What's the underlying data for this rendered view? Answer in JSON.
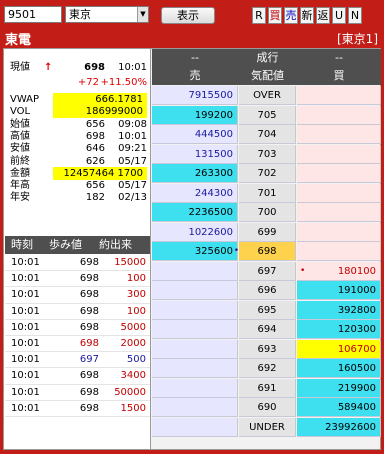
{
  "toolbar": {
    "code": "9501",
    "market": "東京",
    "show_label": "表示",
    "buttons": [
      "R",
      "買",
      "売",
      "新",
      "返",
      "U",
      "N"
    ]
  },
  "title": {
    "name": "東電",
    "market": "[東京1]"
  },
  "quote": {
    "current_label": "現値",
    "current_arrow": "↑",
    "current_price": "698",
    "current_time": "10:01",
    "change": "+72",
    "change_pct": "+11.50%",
    "rows": [
      {
        "label": "VWAP",
        "value": "666.1781",
        "time": "",
        "yellow": true
      },
      {
        "label": "VOL",
        "value": "186999000",
        "time": "",
        "yellow": true
      },
      {
        "label": "始値",
        "value": "656",
        "time": "09:08",
        "yellow": false
      },
      {
        "label": "高値",
        "value": "698",
        "time": "10:01",
        "yellow": false
      },
      {
        "label": "安値",
        "value": "646",
        "time": "09:21",
        "yellow": false
      },
      {
        "label": "前終",
        "value": "626",
        "time": "05/17",
        "yellow": false
      },
      {
        "label": "金額",
        "value": "12457464 1700",
        "time": "",
        "yellow": true
      },
      {
        "label": "年高",
        "value": "656",
        "time": "05/17",
        "yellow": false
      },
      {
        "label": "年安",
        "value": "182",
        "time": "02/13",
        "yellow": false
      }
    ]
  },
  "trades": {
    "headers": [
      "時刻",
      "歩み値",
      "約出来"
    ],
    "rows": [
      {
        "time": "10:01",
        "price": "698",
        "vol": "15000",
        "pc": "#000",
        "vc": "#c00000"
      },
      {
        "time": "10:01",
        "price": "698",
        "vol": "100",
        "pc": "#000",
        "vc": "#c00000"
      },
      {
        "time": "10:01",
        "price": "698",
        "vol": "300",
        "pc": "#000",
        "vc": "#c00000"
      },
      {
        "time": "10:01",
        "price": "698",
        "vol": "100",
        "pc": "#000",
        "vc": "#c00000"
      },
      {
        "time": "10:01",
        "price": "698",
        "vol": "5000",
        "pc": "#000",
        "vc": "#c00000"
      },
      {
        "time": "10:01",
        "price": "698",
        "vol": "2000",
        "pc": "#c00000",
        "vc": "#c00000"
      },
      {
        "time": "10:01",
        "price": "697",
        "vol": "500",
        "pc": "#1a1aa0",
        "vc": "#1a1aa0"
      },
      {
        "time": "10:01",
        "price": "698",
        "vol": "3400",
        "pc": "#000",
        "vc": "#c00000"
      },
      {
        "time": "10:01",
        "price": "698",
        "vol": "50000",
        "pc": "#000",
        "vc": "#c00000"
      },
      {
        "time": "10:01",
        "price": "698",
        "vol": "1500",
        "pc": "#000",
        "vc": "#c00000"
      }
    ]
  },
  "book": {
    "top": {
      "ask": "--",
      "mid": "成行",
      "bid": "--"
    },
    "headers": {
      "ask": "売",
      "mid": "気配値",
      "bid": "買"
    },
    "rows": [
      {
        "ask": "7915500",
        "price": "OVER",
        "bid": "",
        "ask_hl": "",
        "bid_hl": "",
        "px_hl": ""
      },
      {
        "ask": "199200",
        "price": "705",
        "bid": "",
        "ask_hl": "cyan",
        "bid_hl": "",
        "px_hl": ""
      },
      {
        "ask": "444500",
        "price": "704",
        "bid": "",
        "ask_hl": "",
        "bid_hl": "",
        "px_hl": ""
      },
      {
        "ask": "131500",
        "price": "703",
        "bid": "",
        "ask_hl": "",
        "bid_hl": "",
        "px_hl": ""
      },
      {
        "ask": "263300",
        "price": "702",
        "bid": "",
        "ask_hl": "cyan",
        "bid_hl": "",
        "px_hl": ""
      },
      {
        "ask": "244300",
        "price": "701",
        "bid": "",
        "ask_hl": "",
        "bid_hl": "",
        "px_hl": ""
      },
      {
        "ask": "2236500",
        "price": "700",
        "bid": "",
        "ask_hl": "cyan",
        "bid_hl": "",
        "px_hl": ""
      },
      {
        "ask": "1022600",
        "price": "699",
        "bid": "",
        "ask_hl": "",
        "bid_hl": "",
        "px_hl": ""
      },
      {
        "ask": "325600",
        "price": "698",
        "bid": "",
        "ask_hl": "cyan",
        "bid_hl": "",
        "px_hl": "orange",
        "ask_dot": "•"
      },
      {
        "ask": "",
        "price": "697",
        "bid": "180100",
        "ask_hl": "",
        "bid_hl": "",
        "px_hl": "",
        "bid_dot": "•"
      },
      {
        "ask": "",
        "price": "696",
        "bid": "191000",
        "ask_hl": "",
        "bid_hl": "cyan",
        "px_hl": ""
      },
      {
        "ask": "",
        "price": "695",
        "bid": "392800",
        "ask_hl": "",
        "bid_hl": "cyan",
        "px_hl": ""
      },
      {
        "ask": "",
        "price": "694",
        "bid": "120300",
        "ask_hl": "",
        "bid_hl": "cyan",
        "px_hl": ""
      },
      {
        "ask": "",
        "price": "693",
        "bid": "106700",
        "ask_hl": "",
        "bid_hl": "yellow",
        "px_hl": ""
      },
      {
        "ask": "",
        "price": "692",
        "bid": "160500",
        "ask_hl": "",
        "bid_hl": "cyan",
        "px_hl": ""
      },
      {
        "ask": "",
        "price": "691",
        "bid": "219900",
        "ask_hl": "",
        "bid_hl": "cyan",
        "px_hl": ""
      },
      {
        "ask": "",
        "price": "690",
        "bid": "589400",
        "ask_hl": "",
        "bid_hl": "cyan",
        "px_hl": ""
      },
      {
        "ask": "",
        "price": "UNDER",
        "bid": "23992600",
        "ask_hl": "",
        "bid_hl": "cyan",
        "px_hl": ""
      }
    ]
  }
}
